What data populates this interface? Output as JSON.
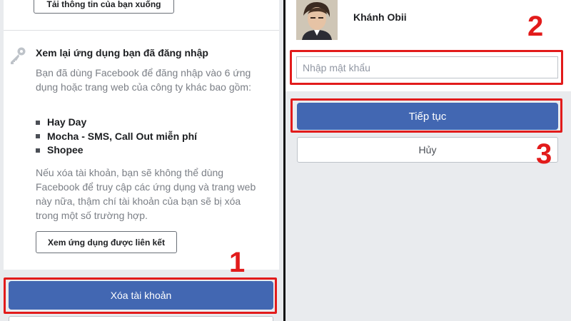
{
  "left": {
    "download_button": "Tải thông tin của bạn xuống",
    "section_icon": "key-icon",
    "section_title": "Xem lại ứng dụng bạn đã đăng nhập",
    "intro_text": "Bạn đã dùng Facebook để đăng nhập vào 6 ứng dụng hoặc trang web của công ty khác bao gồm:",
    "apps": [
      "Hay Day",
      "Mocha - SMS, Call Out miễn phí",
      "Shopee"
    ],
    "warning_text": "Nếu xóa tài khoản, bạn sẽ không thể dùng Facebook để truy cập các ứng dụng và trang web này nữa, thậm chí tài khoản của bạn sẽ bị xóa trong một số trường hợp.",
    "linked_apps_button": "Xem ứng dụng được liên kết",
    "delete_button": "Xóa tài khoản"
  },
  "right": {
    "profile_name": "Khánh Obii",
    "password_placeholder": "Nhập mật khẩu",
    "continue_button": "Tiếp tục",
    "cancel_button": "Hủy"
  },
  "annotations": {
    "step1": "1",
    "step2": "2",
    "step3": "3",
    "highlight_color": "#e21b1b"
  },
  "colors": {
    "primary_button": "#4267b2",
    "background_grey": "#e9ebee"
  }
}
